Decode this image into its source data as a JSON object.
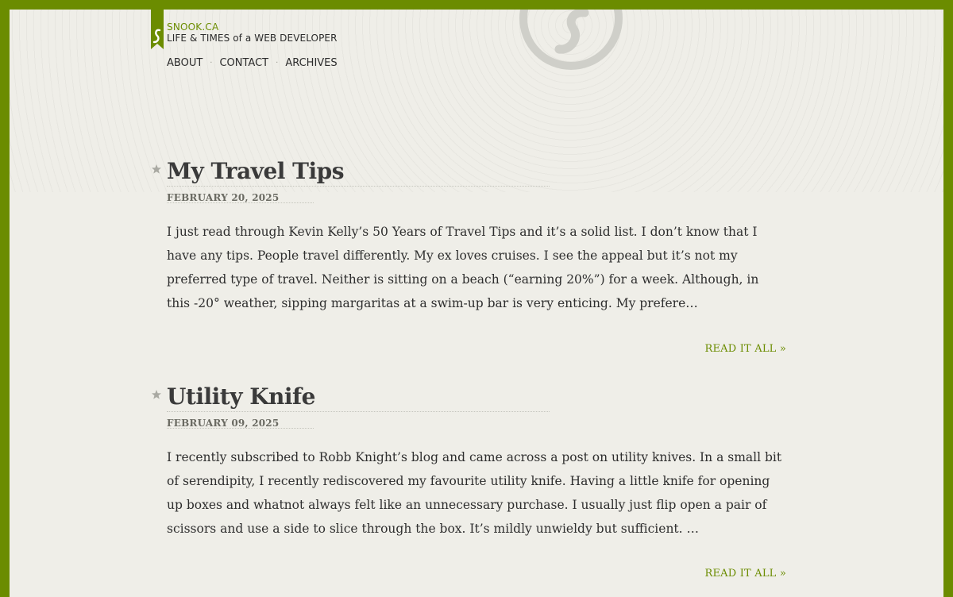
{
  "site": {
    "name": "SNOOK.CA",
    "tagline": "LIFE & TIMES of a WEB DEVELOPER"
  },
  "nav": {
    "items": [
      {
        "label": "ABOUT"
      },
      {
        "label": "CONTACT"
      },
      {
        "label": "ARCHIVES"
      }
    ],
    "separator": "·"
  },
  "colors": {
    "accent": "#6b8c00",
    "background": "#efeee8",
    "text": "#2e2e2e"
  },
  "icons": [
    "bookmark-logo-icon",
    "swirl-logo-icon",
    "star-icon"
  ],
  "posts": [
    {
      "title": "My Travel Tips",
      "date": "FEBRUARY 20, 2025",
      "excerpt": "I just read through Kevin Kelly’s 50 Years of Travel Tips and it’s a solid list. I don’t know that I have any tips. People travel differently. My ex loves cruises. I see the appeal but it’s not my preferred type of travel. Neither is sitting on a beach (“earning 20%”) for a week. Although, in this -20° weather, sipping margaritas at a swim-up bar is very enticing. My prefere…",
      "read_more": "READ IT ALL »"
    },
    {
      "title": "Utility Knife",
      "date": "FEBRUARY 09, 2025",
      "excerpt": "I recently subscribed to Robb Knight’s blog and came across a post on utility knives. In a small bit of serendipity, I recently rediscovered my favourite utility knife. Having a little knife for opening up boxes and whatnot always felt like an unnecessary purchase. I usually just flip open a pair of scissors and use a side to slice through the box. It’s mildly unwieldy but sufficient. …",
      "read_more": "READ IT ALL »"
    }
  ]
}
